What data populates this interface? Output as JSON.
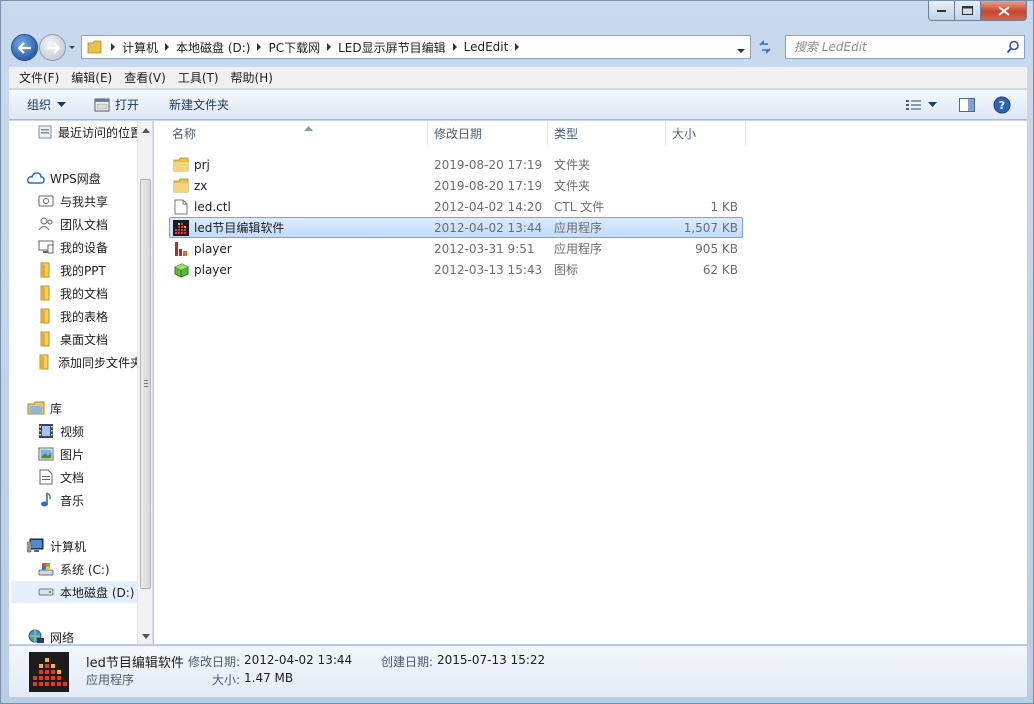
{
  "address": {
    "crumbs": [
      "计算机",
      "本地磁盘 (D:)",
      "PC下载网",
      "LED显示屏节目编辑",
      "LedEdit"
    ]
  },
  "search": {
    "placeholder": "搜索 LedEdit"
  },
  "menu": [
    "文件(F)",
    "编辑(E)",
    "查看(V)",
    "工具(T)",
    "帮助(H)"
  ],
  "command_bar": {
    "organize": "组织",
    "open": "打开",
    "new_folder": "新建文件夹"
  },
  "nav": {
    "recent": "最近访问的位置",
    "wps": "WPS网盘",
    "shared": "与我共享",
    "team_docs": "团队文档",
    "my_devices": "我的设备",
    "my_ppt": "我的PPT",
    "my_docs": "我的文档",
    "my_sheets": "我的表格",
    "desktop_docs": "桌面文档",
    "add_sync": "添加同步文件夹",
    "libraries": "库",
    "videos": "视频",
    "pictures": "图片",
    "documents": "文档",
    "music": "音乐",
    "computer": "计算机",
    "drive_c": "系统 (C:)",
    "drive_d": "本地磁盘 (D:)",
    "network": "网络"
  },
  "columns": {
    "name": "名称",
    "date": "修改日期",
    "type": "类型",
    "size": "大小"
  },
  "files": [
    {
      "name": "prj",
      "date": "2019-08-20 17:19",
      "type": "文件夹",
      "size": "",
      "icon": "folder-icon"
    },
    {
      "name": "zx",
      "date": "2019-08-20 17:19",
      "type": "文件夹",
      "size": "",
      "icon": "folder-icon"
    },
    {
      "name": "led.ctl",
      "date": "2012-04-02 14:20",
      "type": "CTL 文件",
      "size": "1 KB",
      "icon": "file-icon"
    },
    {
      "name": "led节目编辑软件",
      "date": "2012-04-02 13:44",
      "type": "应用程序",
      "size": "1,507 KB",
      "icon": "led-app-icon",
      "selected": true
    },
    {
      "name": "player",
      "date": "2012-03-31 9:51",
      "type": "应用程序",
      "size": "905 KB",
      "icon": "player-app-icon"
    },
    {
      "name": "player",
      "date": "2012-03-13 15:43",
      "type": "图标",
      "size": "62 KB",
      "icon": "player-ico-icon"
    }
  ],
  "details": {
    "name": "led节目编辑软件",
    "type": "应用程序",
    "modified_label": "修改日期:",
    "modified": "2012-04-02 13:44",
    "created_label": "创建日期:",
    "created": "2015-07-13 15:22",
    "size_label": "大小:",
    "size": "1.47 MB"
  },
  "colors": {
    "selection_bg": "#c9e0fb",
    "selection_border": "#7da2ce",
    "folder": "#e8c04f"
  }
}
